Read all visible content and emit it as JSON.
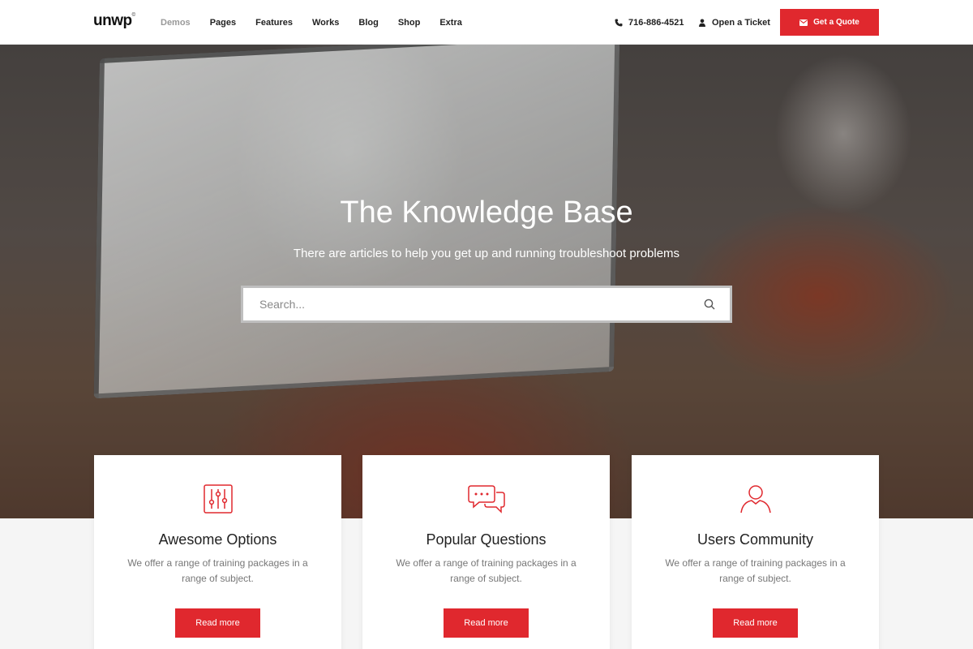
{
  "header": {
    "logo": "unwp",
    "logo_mark": "©",
    "nav": [
      "Demos",
      "Pages",
      "Features",
      "Works",
      "Blog",
      "Shop",
      "Extra"
    ],
    "phone": "716-886-4521",
    "ticket": "Open a Ticket",
    "quote": "Get a Quote"
  },
  "hero": {
    "title": "The Knowledge Base",
    "subtitle": "There are articles to help you get up and running troubleshoot problems",
    "search_placeholder": "Search..."
  },
  "cards": [
    {
      "icon": "sliders-icon",
      "title": "Awesome Options",
      "text": "We offer a range of training packages in a range of subject.",
      "button": "Read more"
    },
    {
      "icon": "chat-bubbles-icon",
      "title": "Popular Questions",
      "text": "We offer a range of training packages in a range of subject.",
      "button": "Read more"
    },
    {
      "icon": "user-icon",
      "title": "Users Community",
      "text": "We offer a range of training packages in a range of subject.",
      "button": "Read more"
    }
  ],
  "colors": {
    "accent": "#e0282e"
  }
}
